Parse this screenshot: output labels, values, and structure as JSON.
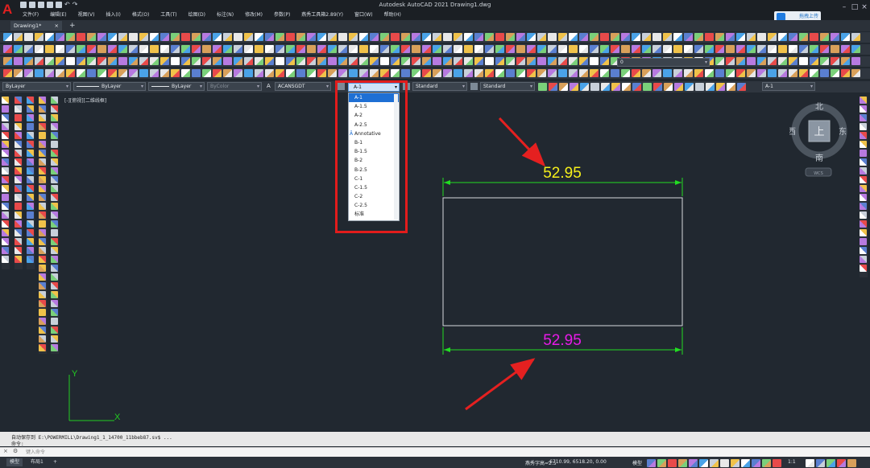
{
  "window": {
    "title": "Autodesk AutoCAD 2021    Drawing1.dwg",
    "share_button": "拖拽上传",
    "min_icon": "minimize-icon",
    "max_icon": "maximize-icon",
    "close_icon": "close-icon"
  },
  "menu": [
    "文件(F)",
    "编辑(E)",
    "视图(V)",
    "插入(I)",
    "格式(O)",
    "工具(T)",
    "绘图(D)",
    "标注(N)",
    "修改(M)",
    "参数(P)",
    "燕秀工具箱2.89(Y)",
    "窗口(W)",
    "帮助(H)"
  ],
  "tabs": {
    "active": "Drawing1*",
    "close_glyph": "×",
    "add_glyph": "+"
  },
  "properties": {
    "color": "ByLayer",
    "linetype": "ByLayer",
    "lineweight": "ByLayer",
    "plotstyle": "ByColor",
    "text_style": "ACANSGDT",
    "dim_style": "A-1",
    "table_style": "Standard",
    "multileader_style": "Standard",
    "dim_style_right": "A-1",
    "layer": "0"
  },
  "dim_style_dropdown": [
    {
      "label": "A-1",
      "selected": true
    },
    {
      "label": "A-1.5"
    },
    {
      "label": "A-2"
    },
    {
      "label": "A-2.5"
    },
    {
      "label": "Annotative",
      "icon": "annotative-icon"
    },
    {
      "label": "B-1"
    },
    {
      "label": "B-1.5"
    },
    {
      "label": "B-2"
    },
    {
      "label": "B-2.5"
    },
    {
      "label": "C-1"
    },
    {
      "label": "C-1.5"
    },
    {
      "label": "C-2"
    },
    {
      "label": "C-2.5"
    },
    {
      "label": "标准"
    }
  ],
  "canvas": {
    "view_label": "[-][俯视][二维线框]",
    "dim_top_value": "52.95",
    "dim_bottom_value": "52.95",
    "dim_top_color": "#f6f01a",
    "dim_bottom_color": "#e81ae8",
    "dim_line_color": "#22dd22",
    "arrow_color": "#e52020",
    "ucs_x": "X",
    "ucs_y": "Y"
  },
  "viewcube": {
    "north": "北",
    "south": "南",
    "east": "东",
    "west": "西",
    "top": "上",
    "wcs": "WCS"
  },
  "command": {
    "history_1": "自动保存到 E:\\POWERMILL\\Drawing1_1_14700_11bbeb87.sv$ ...",
    "history_2": "命令:",
    "placeholder": "键入命令"
  },
  "status": {
    "tab_model": "模型",
    "tab_layout": "布局1",
    "annotation_scale": "燕秀字高=2.5",
    "coordinates": "-6710.99, 6518.20, 0.00",
    "space": "模型",
    "scale": "1:1"
  }
}
